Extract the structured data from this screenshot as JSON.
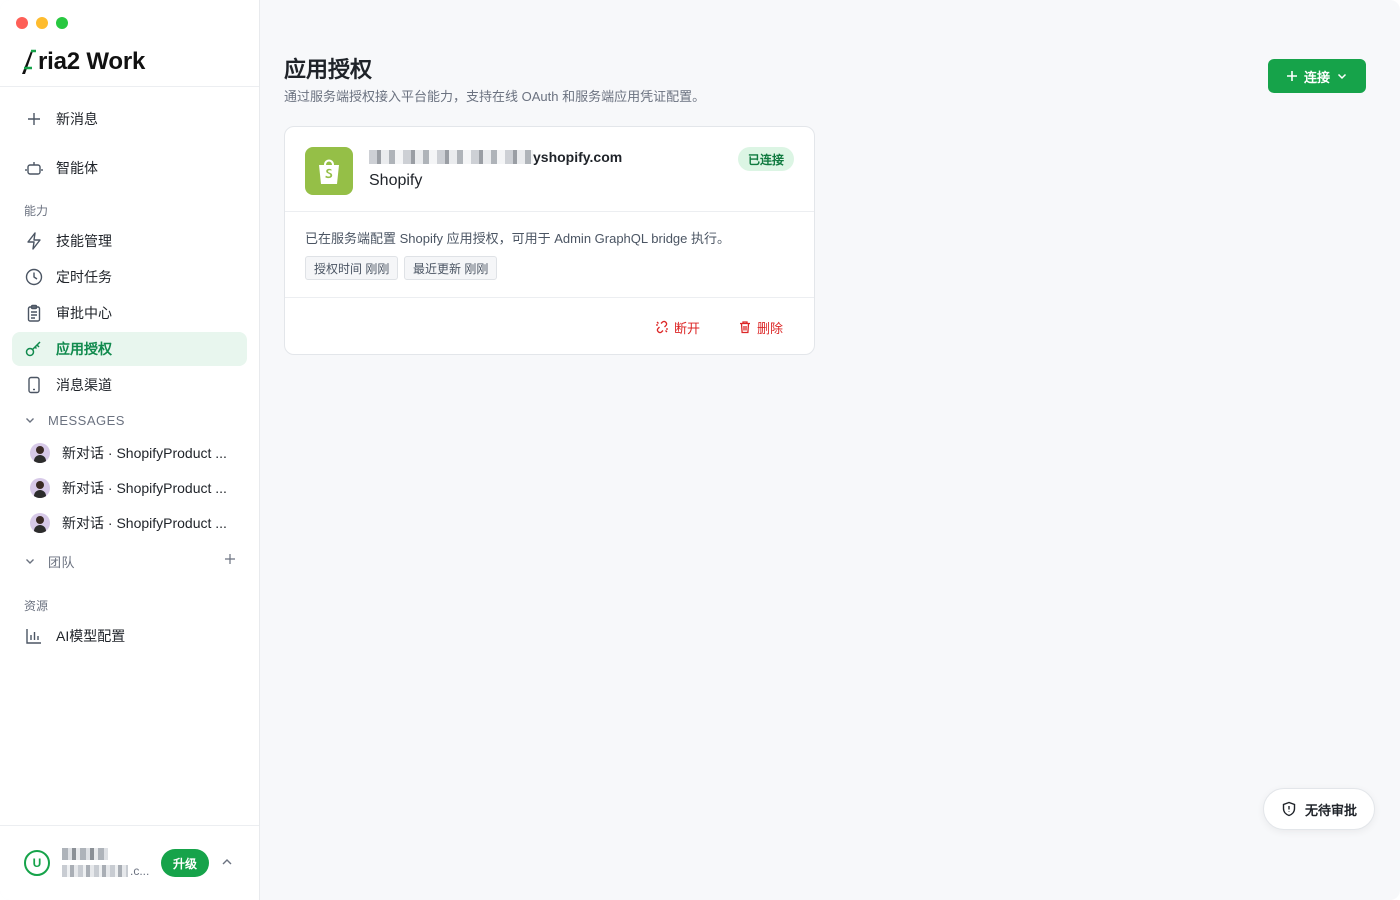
{
  "brand": {
    "name": "ria2 Work",
    "accent": "#16a34a"
  },
  "sidebar": {
    "new_message": "新消息",
    "agent": "智能体",
    "section_capabilities": "能力",
    "items": [
      {
        "label": "技能管理",
        "icon": "lightning-icon"
      },
      {
        "label": "定时任务",
        "icon": "clock-icon"
      },
      {
        "label": "审批中心",
        "icon": "clipboard-icon"
      },
      {
        "label": "应用授权",
        "icon": "key-icon",
        "active": true
      },
      {
        "label": "消息渠道",
        "icon": "phone-icon"
      }
    ],
    "messages_header": "MESSAGES",
    "messages": [
      {
        "title": "新对话 · ShopifyProduct ..."
      },
      {
        "title": "新对话 · ShopifyProduct ..."
      },
      {
        "title": "新对话 · ShopifyProduct ..."
      }
    ],
    "team_header": "团队",
    "section_resources": "资源",
    "ai_model": "AI模型配置",
    "user": {
      "initial": "U",
      "email_suffix": ".c...",
      "upgrade": "升级"
    }
  },
  "main": {
    "title": "应用授权",
    "description": "通过服务端授权接入平台能力，支持在线 OAuth 和服务端应用凭证配置。",
    "connect_button": "连接",
    "card": {
      "domain_suffix": "yshopify.com",
      "app_name": "Shopify",
      "status": "已连接",
      "body": "已在服务端配置 Shopify 应用授权，可用于 Admin GraphQL bridge 执行。",
      "tags": [
        "授权时间 刚刚",
        "最近更新 刚刚"
      ],
      "disconnect": "断开",
      "delete": "删除"
    },
    "approval_button": "无待审批"
  }
}
